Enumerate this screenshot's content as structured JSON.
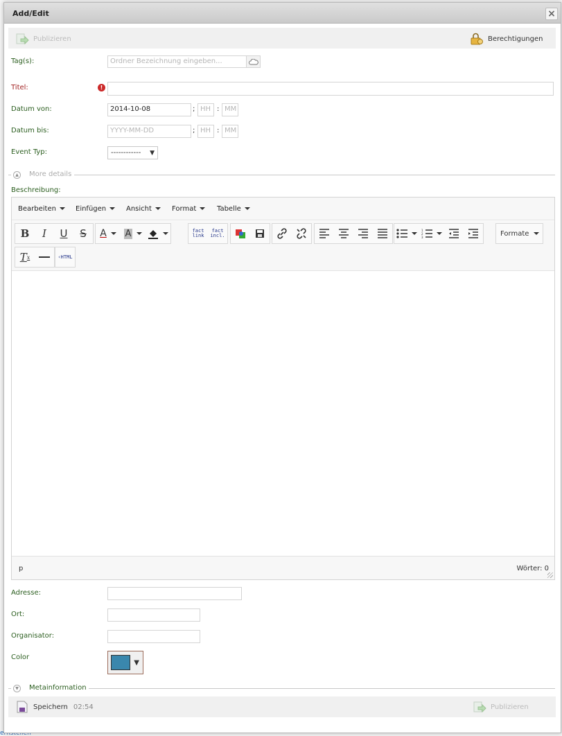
{
  "dialog": {
    "title": "Add/Edit",
    "close_label": "×"
  },
  "topbar": {
    "publish_label": "Publizieren",
    "permissions_label": "Berechtigungen"
  },
  "form": {
    "tags_label": "Tag(s):",
    "tags_placeholder": "Ordner Bezeichnung eingeben...",
    "title_label": "Titel:",
    "title_value": "",
    "date_from_label": "Datum von:",
    "date_from_value": "2014-10-08",
    "date_to_label": "Datum bis:",
    "date_placeholder": "YYYY-MM-DD",
    "hour_placeholder": "HH",
    "minute_placeholder": "MM",
    "time_separator": ";",
    "time_colon": ":",
    "event_type_label": "Event Typ:",
    "event_type_value": "------------",
    "more_details_label": "More details",
    "description_label": "Beschreibung:",
    "address_label": "Adresse:",
    "city_label": "Ort:",
    "organizer_label": "Organisator:",
    "color_label": "Color",
    "color_value": "#3a87ad",
    "metainfo_label": "Metainformation"
  },
  "editor": {
    "menus": [
      "Bearbeiten",
      "Einfügen",
      "Ansicht",
      "Format",
      "Tabelle"
    ],
    "formats_label": "Formate",
    "path": "p",
    "word_count": "Wörter: 0"
  },
  "bottombar": {
    "save_label": "Speichern",
    "save_time": "02:54",
    "publish_label": "Publizieren"
  },
  "background": {
    "link_text": "ernstellen"
  },
  "colors": {
    "label_green": "#2a5d1e",
    "label_required": "#a02020",
    "accent_blue": "#3a87ad"
  }
}
